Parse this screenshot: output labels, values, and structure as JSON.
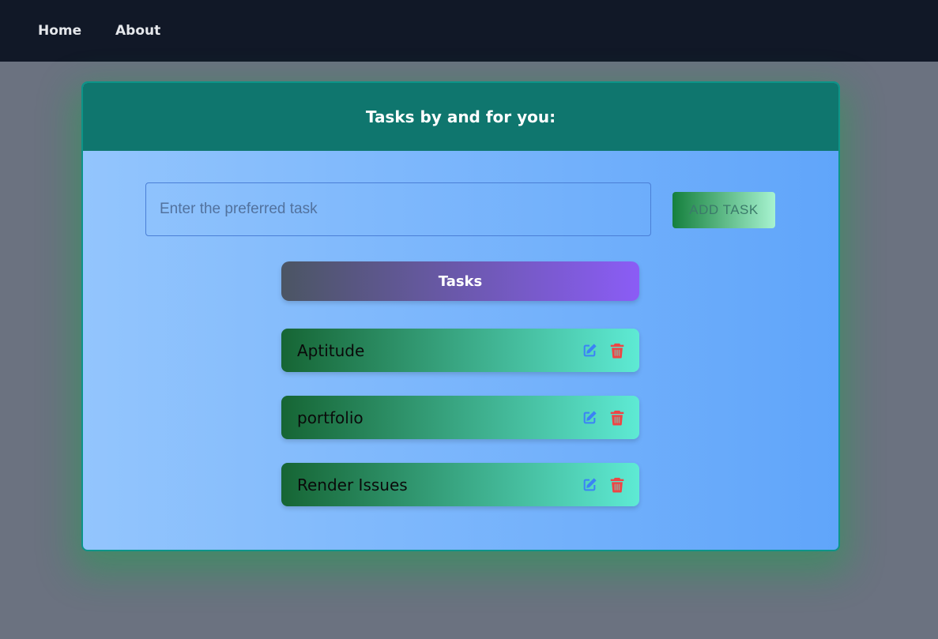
{
  "nav": {
    "home_label": "Home",
    "about_label": "About"
  },
  "card": {
    "title": "Tasks by and for you:"
  },
  "task_input": {
    "placeholder": "Enter the preferred task",
    "value": ""
  },
  "add_button": {
    "label": "ADD TASK"
  },
  "tasks_heading": "Tasks",
  "tasks": [
    {
      "label": "Aptitude",
      "actions": [
        "edit-icon",
        "trash-icon"
      ]
    },
    {
      "label": "portfolio",
      "actions": [
        "edit-icon",
        "trash-icon"
      ]
    },
    {
      "label": "Render Issues",
      "actions": [
        "edit-icon",
        "trash-icon"
      ]
    }
  ],
  "colors": {
    "navbar": "#111827",
    "page_background": "#6b7280",
    "card_header": "#0f766e",
    "edit_icon": "#3b82f6",
    "trash_icon": "#ef4444"
  }
}
